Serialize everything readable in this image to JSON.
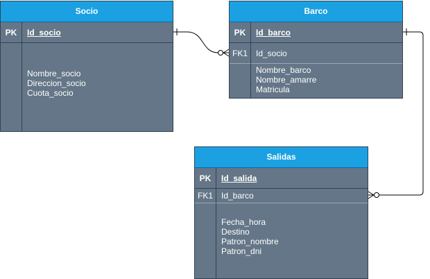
{
  "entities": {
    "socio": {
      "title": "Socio",
      "pk_label": "PK",
      "pk_name": "Id_socio",
      "attributes": [
        "Nombre_socio",
        "Direccion_socio",
        "Cuota_socio"
      ]
    },
    "barco": {
      "title": "Barco",
      "pk_label": "PK",
      "pk_name": "Id_barco",
      "fk_label": "FK1",
      "fk_name": "Id_socio",
      "attributes": [
        "Nombre_barco",
        "Nombre_amarre",
        "Matricula"
      ]
    },
    "salidas": {
      "title": "Salidas",
      "pk_label": "PK",
      "pk_name": "Id_salida",
      "fk_label": "FK1",
      "fk_name": "Id_barco",
      "attributes": [
        "Fecha_hora",
        "Destino",
        "Patron_nombre",
        "Patron_dni"
      ]
    }
  },
  "colors": {
    "header": "#1ba1e2",
    "body": "#647687",
    "border": "#314354",
    "connector": "#000000"
  }
}
